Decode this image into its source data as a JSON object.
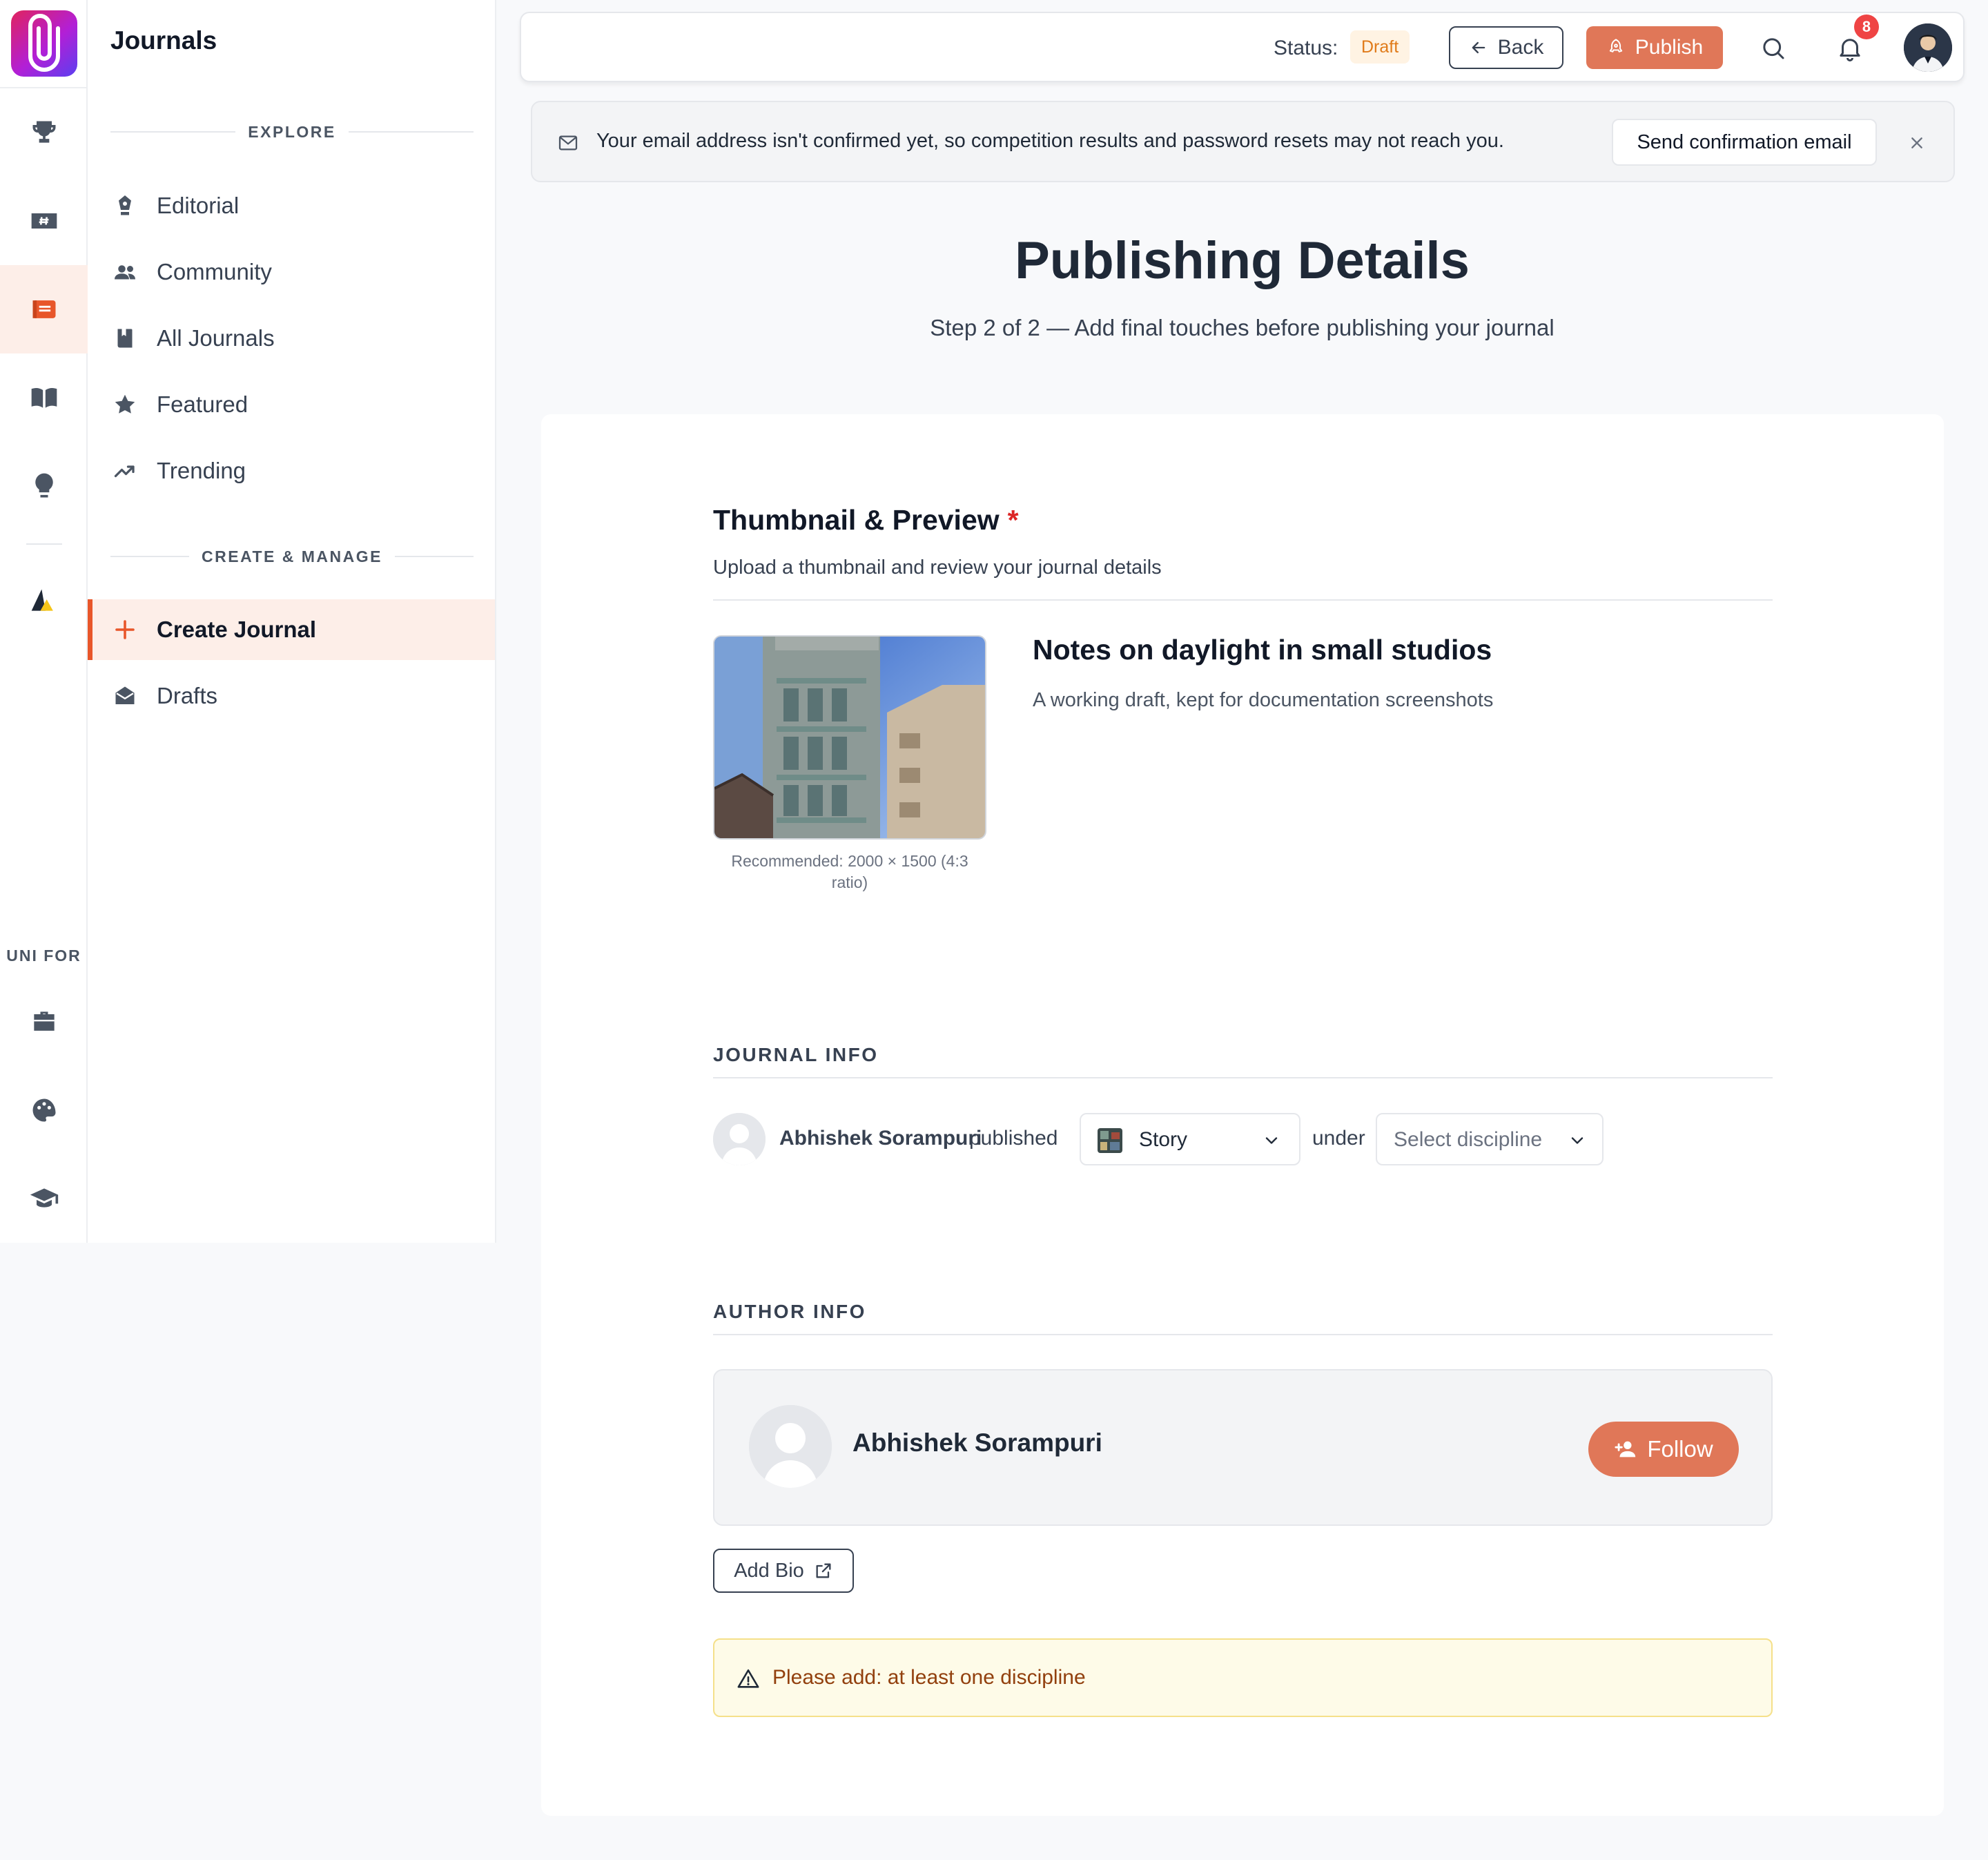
{
  "sidebar": {
    "title": "Journals",
    "explore_label": "EXPLORE",
    "explore_items": [
      {
        "label": "Editorial",
        "icon": "pen-nib-icon"
      },
      {
        "label": "Community",
        "icon": "users-icon"
      },
      {
        "label": "All Journals",
        "icon": "book-icon"
      },
      {
        "label": "Featured",
        "icon": "star-icon"
      },
      {
        "label": "Trending",
        "icon": "trending-up-icon"
      }
    ],
    "manage_label": "CREATE & MANAGE",
    "manage_items": [
      {
        "label": "Create Journal",
        "icon": "plus-icon",
        "active": true
      },
      {
        "label": "Drafts",
        "icon": "envelope-open-icon"
      }
    ]
  },
  "rail": {
    "items": [
      "trophy-icon",
      "hashtag-ticket-icon",
      "journal-icon",
      "open-book-icon",
      "lightbulb-icon",
      "triangle-logo-icon"
    ],
    "active_index": 2,
    "uni_label": "UNI FOR",
    "uni_items": [
      "briefcase-icon",
      "palette-icon",
      "graduation-cap-icon"
    ]
  },
  "topbar": {
    "status_label": "Status:",
    "status_value": "Draft",
    "back_label": "Back",
    "publish_label": "Publish",
    "notification_count": "8"
  },
  "banner": {
    "text": "Your email address isn't confirmed yet, so competition results and password resets may not reach you.",
    "button_label": "Send confirmation email"
  },
  "page": {
    "title": "Publishing Details",
    "subtitle": "Step 2 of 2 — Add final touches before publishing your journal"
  },
  "thumbnail_section": {
    "heading": "Thumbnail & Preview",
    "required_mark": "*",
    "description": "Upload a thumbnail and review your journal details",
    "recommendation": "Recommended: 2000 × 1500 (4:3 ratio)",
    "journal_title": "Notes on daylight in small studios",
    "journal_subtitle": "A working draft, kept for documentation screenshots"
  },
  "journal_info": {
    "heading": "JOURNAL INFO",
    "author": "Abhishek Sorampuri",
    "published_word": "published",
    "type_value": "Story",
    "under_word": "under",
    "discipline_placeholder": "Select discipline"
  },
  "author_info": {
    "heading": "AUTHOR INFO",
    "name": "Abhishek Sorampuri",
    "follow_label": "Follow",
    "add_bio_label": "Add Bio"
  },
  "warning": {
    "text": "Please add: at least one discipline"
  },
  "colors": {
    "accent": "#e8562a",
    "button_accent": "#e07758",
    "active_bg": "#fdeee8",
    "draft_badge": "#e07b1a",
    "warning_bg": "#fefbe8"
  }
}
